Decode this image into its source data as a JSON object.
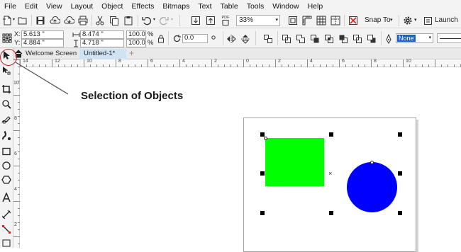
{
  "menu": [
    "File",
    "Edit",
    "View",
    "Layout",
    "Object",
    "Effects",
    "Bitmaps",
    "Text",
    "Table",
    "Tools",
    "Window",
    "Help"
  ],
  "toolbar": {
    "zoom": "33%",
    "snap_to": "Snap To",
    "launch": "Launch",
    "pdf_label": "PDF"
  },
  "properties": {
    "x_label": "X:",
    "x_value": "5.613 \"",
    "y_label": "Y:",
    "y_value": "4.884 \"",
    "width_value": "8.474 \"",
    "height_value": "4.718 \"",
    "scale_w": "100.0",
    "scale_h": "100.0",
    "percent": "%",
    "rotation": "0.0",
    "outline_none": "None"
  },
  "tabs": {
    "welcome": "Welcome Screen",
    "document": "Untitled-1*",
    "add": "+"
  },
  "rulers": {
    "horizontal": [
      "14",
      "12",
      "10",
      "8",
      "6",
      "4",
      "2",
      "0",
      "2",
      "4",
      "6",
      "8",
      "10"
    ],
    "vertical": [
      "10",
      "8",
      "6",
      "4",
      "2"
    ]
  },
  "annotation": "Selection of Objects",
  "colors": {
    "green_rect": "#00ff00",
    "blue_circle": "#0000ff",
    "callout": "#cc2222",
    "outline_highlight": "#1a5fd6"
  }
}
